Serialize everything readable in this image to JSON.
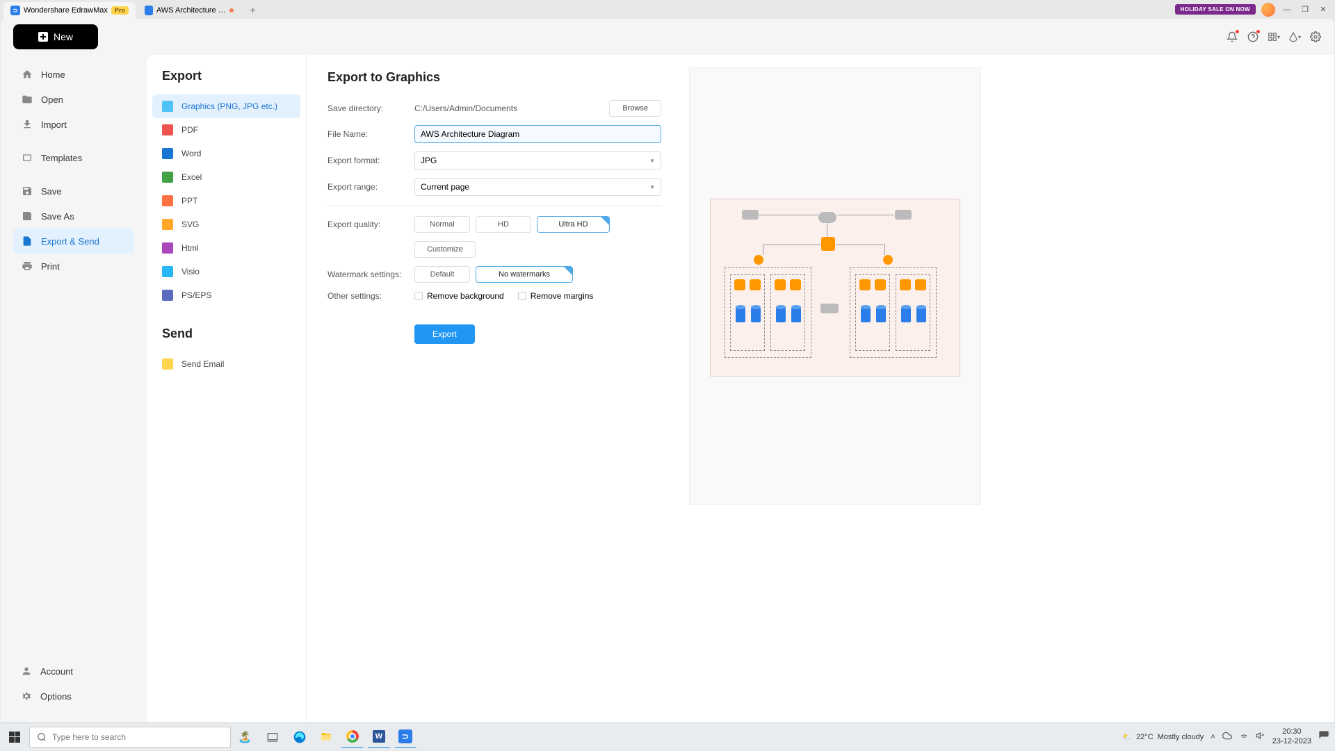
{
  "titlebar": {
    "app_tab": "Wondershare EdrawMax",
    "pro_badge": "Pro",
    "doc_tab": "AWS Architecture …",
    "holiday": "HOLIDAY SALE ON NOW"
  },
  "appbar": {
    "new": "New"
  },
  "sidebar": {
    "home": "Home",
    "open": "Open",
    "import": "Import",
    "templates": "Templates",
    "save": "Save",
    "saveas": "Save As",
    "export": "Export & Send",
    "print": "Print",
    "account": "Account",
    "options": "Options"
  },
  "export_list": {
    "title": "Export",
    "graphics": "Graphics (PNG, JPG etc.)",
    "pdf": "PDF",
    "word": "Word",
    "excel": "Excel",
    "ppt": "PPT",
    "svg": "SVG",
    "html": "Html",
    "visio": "Visio",
    "pseps": "PS/EPS",
    "send_title": "Send",
    "send_email": "Send Email"
  },
  "form": {
    "title": "Export to Graphics",
    "save_dir_label": "Save directory:",
    "save_dir_value": "C:/Users/Admin/Documents",
    "browse": "Browse",
    "filename_label": "File Name:",
    "filename_value": "AWS Architecture Diagram",
    "format_label": "Export format:",
    "format_value": "JPG",
    "range_label": "Export range:",
    "range_value": "Current page",
    "quality_label": "Export quality:",
    "q_normal": "Normal",
    "q_hd": "HD",
    "q_ultra": "Ultra HD",
    "customize": "Customize",
    "watermark_label": "Watermark settings:",
    "w_default": "Default",
    "w_none": "No watermarks",
    "other_label": "Other settings:",
    "remove_bg": "Remove background",
    "remove_margin": "Remove margins",
    "export_btn": "Export"
  },
  "taskbar": {
    "search_placeholder": "Type here to search",
    "temp": "22°C",
    "weather": "Mostly cloudy",
    "time": "20:30",
    "date": "23-12-2023"
  }
}
